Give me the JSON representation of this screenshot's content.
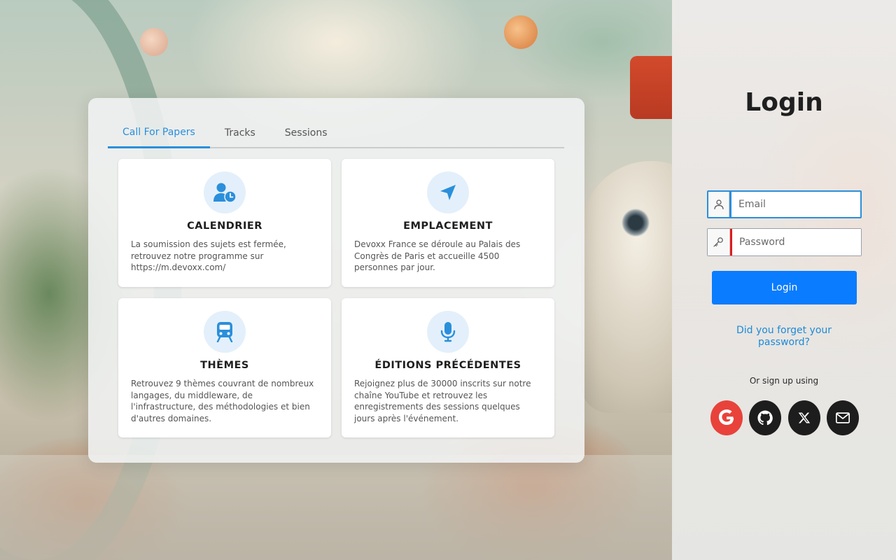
{
  "tabs": [
    {
      "label": "Call For Papers",
      "active": true
    },
    {
      "label": "Tracks",
      "active": false
    },
    {
      "label": "Sessions",
      "active": false
    }
  ],
  "features": [
    {
      "icon": "user-clock-icon",
      "title": "CALENDRIER",
      "text": "La soumission des sujets est fermée, retrouvez notre programme sur https://m.devoxx.com/"
    },
    {
      "icon": "location-arrow-icon",
      "title": "EMPLACEMENT",
      "text": "Devoxx France se déroule au Palais des Congrès de Paris et accueille 4500 personnes par jour."
    },
    {
      "icon": "train-icon",
      "title": "THÈMES",
      "text": "Retrouvez 9 thèmes couvrant de nombreux langages, du middleware, de l'infrastructure, des méthodologies et bien d'autres domaines."
    },
    {
      "icon": "microphone-icon",
      "title": "ÉDITIONS PRÉCÉDENTES",
      "text": "Rejoignez plus de 30000 inscrits sur notre chaîne YouTube et retrouvez les enregistrements des sessions quelques jours après l'événement."
    }
  ],
  "login": {
    "title": "Login",
    "email_placeholder": "Email",
    "password_placeholder": "Password",
    "button_label": "Login",
    "forgot_label": "Did you forget your password?",
    "or_signup": "Or sign up using"
  },
  "social": [
    {
      "name": "google",
      "icon": "google-icon",
      "color": "#e8423b"
    },
    {
      "name": "github",
      "icon": "github-icon",
      "color": "#1d1d1d"
    },
    {
      "name": "x",
      "icon": "x-icon",
      "color": "#1d1d1d"
    },
    {
      "name": "email",
      "icon": "mail-icon",
      "color": "#1d1d1d"
    }
  ],
  "colors": {
    "accent": "#2b8fdb",
    "primary_button": "#0a7cff",
    "error_bar": "#e01b1b"
  }
}
